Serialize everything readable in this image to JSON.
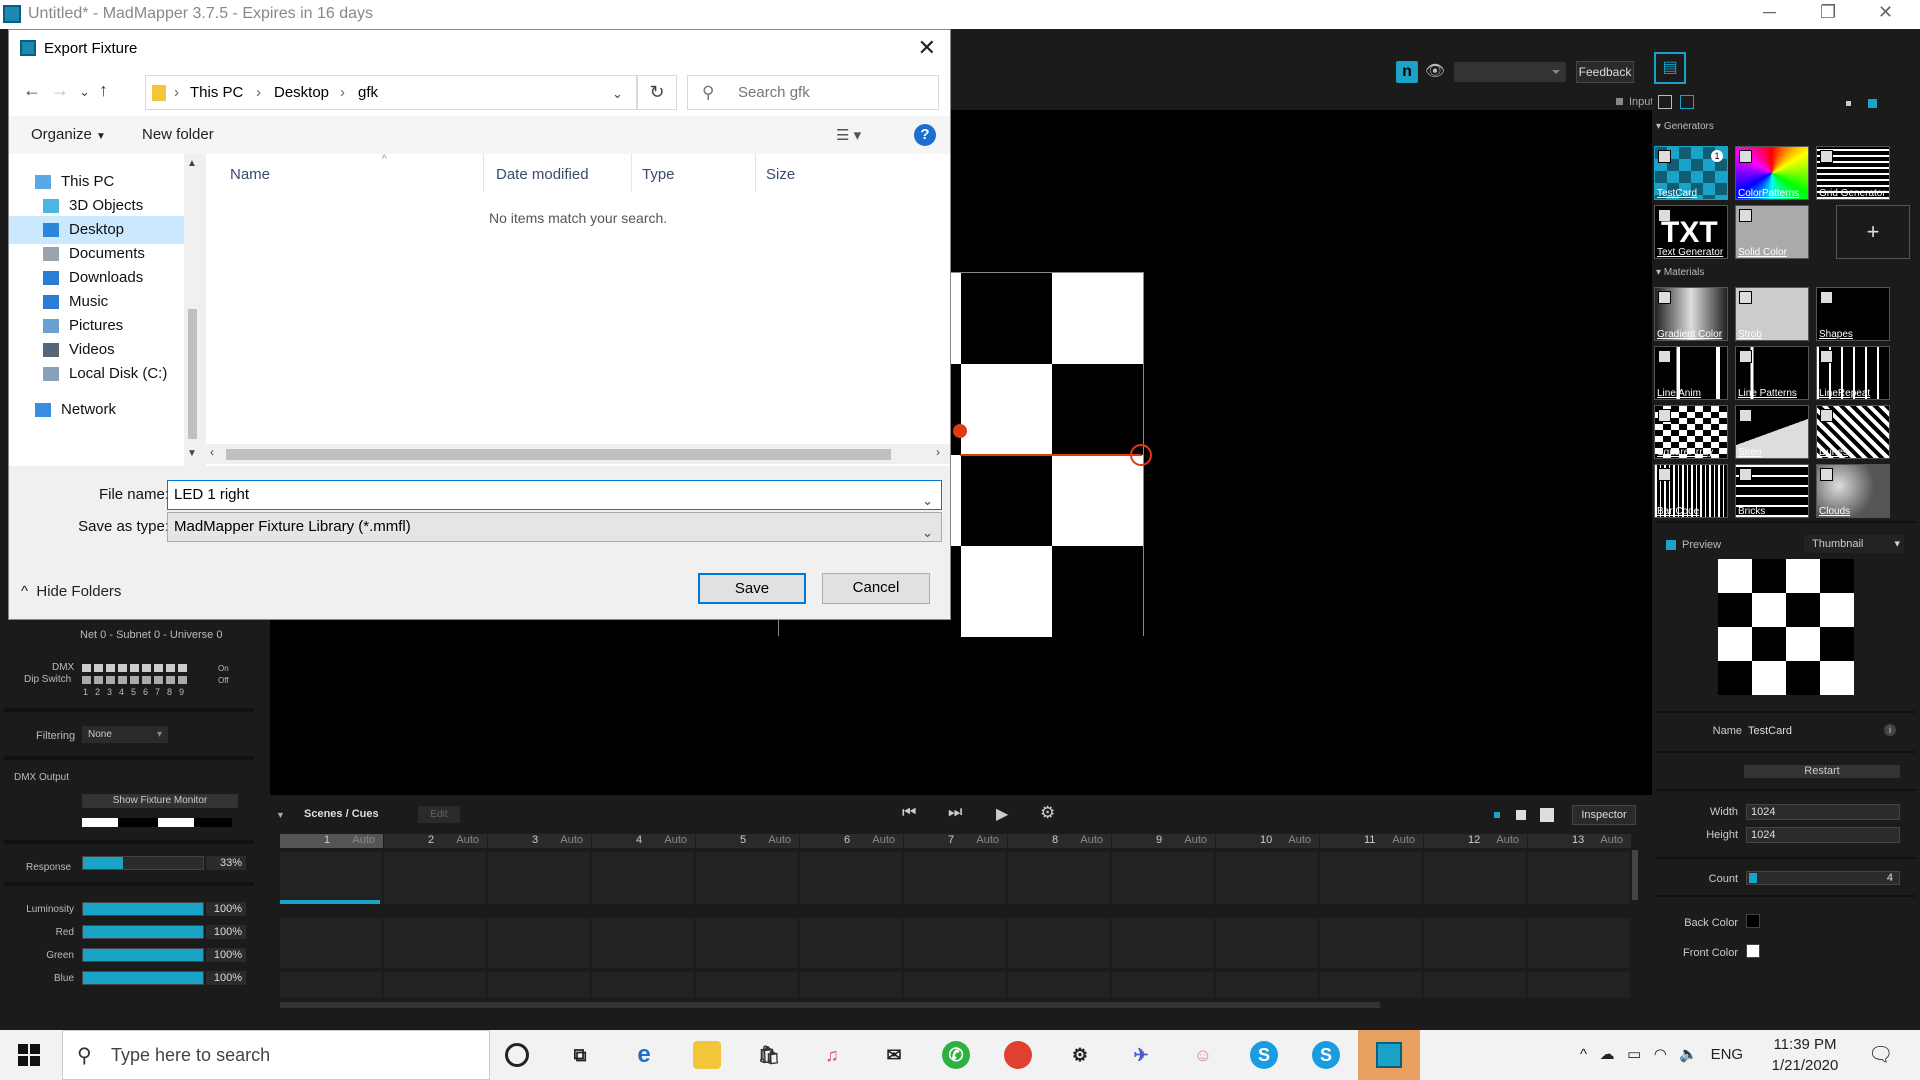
{
  "window": {
    "title": "Untitled* - MadMapper 3.7.5 - Expires in 16 days"
  },
  "toolbar": {
    "feedback_label": "Feedback",
    "dropdown_value": ""
  },
  "viewport": {
    "input_label": "Input"
  },
  "dialog": {
    "title": "Export Fixture",
    "breadcrumb": [
      "This PC",
      "Desktop",
      "gfk"
    ],
    "search_placeholder": "Search gfk",
    "organize_label": "Organize",
    "new_folder_label": "New folder",
    "tree": [
      {
        "label": "This PC",
        "icon": "computer-icon"
      },
      {
        "label": "3D Objects",
        "icon": "cube-icon"
      },
      {
        "label": "Desktop",
        "icon": "desktop-icon",
        "selected": true
      },
      {
        "label": "Documents",
        "icon": "document-icon"
      },
      {
        "label": "Downloads",
        "icon": "download-icon"
      },
      {
        "label": "Music",
        "icon": "music-icon"
      },
      {
        "label": "Pictures",
        "icon": "picture-icon"
      },
      {
        "label": "Videos",
        "icon": "video-icon"
      },
      {
        "label": "Local Disk (C:)",
        "icon": "disk-icon"
      },
      {
        "label": "Network",
        "icon": "network-icon"
      }
    ],
    "columns": [
      "Name",
      "Date modified",
      "Type",
      "Size"
    ],
    "empty_message": "No items match your search.",
    "file_name_label": "File name:",
    "file_name_value": "LED 1 right",
    "save_type_label": "Save as type:",
    "save_type_value": "MadMapper Fixture Library (*.mmfl)",
    "save_label": "Save",
    "cancel_label": "Cancel",
    "hide_folders_label": "Hide Folders"
  },
  "left_panel": {
    "network_text": "Net 0 - Subnet 0 - Universe 0",
    "dmx_label": "DMX",
    "dip_label": "Dip Switch",
    "dip_numbers": [
      "1",
      "2",
      "3",
      "4",
      "5",
      "6",
      "7",
      "8",
      "9"
    ],
    "dip_on": "On",
    "dip_off": "Off",
    "filtering_label": "Filtering",
    "filtering_value": "None",
    "dmx_output_label": "DMX Output",
    "show_monitor_label": "Show Fixture Monitor",
    "response_label": "Response",
    "response_value": "33%",
    "response_level": 0.33,
    "sliders": [
      {
        "label": "Luminosity",
        "value": "100%"
      },
      {
        "label": "Red",
        "value": "100%"
      },
      {
        "label": "Green",
        "value": "100%"
      },
      {
        "label": "Blue",
        "value": "100%"
      }
    ]
  },
  "right_panel": {
    "generators_label": "Generators",
    "generators": [
      "TestCard",
      "ColorPatterns",
      "Grid Generator",
      "Text Generator",
      "Solid Color"
    ],
    "testcard_badge": "1",
    "materials_label": "Materials",
    "materials": [
      "Gradient Color",
      "Strob",
      "Shapes",
      "Line Anim",
      "Line Patterns",
      "LineRepeat",
      "SquareArray",
      "Siren",
      "Dunes",
      "Bar Code",
      "Bricks",
      "Clouds"
    ],
    "preview_label": "Preview",
    "preview_mode": "Thumbnail",
    "name_label": "Name",
    "name_value": "TestCard",
    "restart_label": "Restart",
    "width_label": "Width",
    "width_value": "1024",
    "height_label": "Height",
    "height_value": "1024",
    "count_label": "Count",
    "count_value": "4",
    "back_color_label": "Back Color",
    "front_color_label": "Front Color",
    "accent_color": "#1aa3c6"
  },
  "scenes": {
    "title": "Scenes / Cues",
    "edit_label": "Edit",
    "inspector_label": "Inspector",
    "auto_label": "Auto",
    "columns": [
      "1",
      "2",
      "3",
      "4",
      "5",
      "6",
      "7",
      "8",
      "9",
      "10",
      "11",
      "12",
      "13"
    ]
  },
  "taskbar": {
    "search_placeholder": "Type here to search",
    "language": "ENG",
    "time": "11:39 PM",
    "date": "1/21/2020"
  }
}
